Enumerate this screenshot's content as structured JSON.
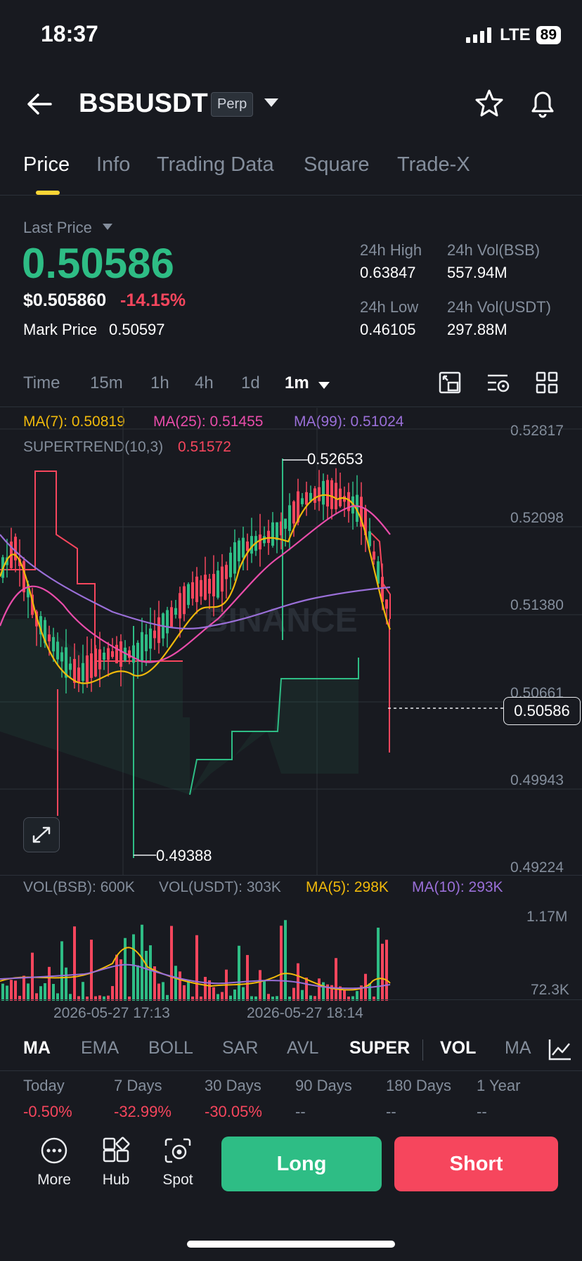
{
  "status_bar": {
    "time": "18:37",
    "network": "LTE",
    "battery": "89"
  },
  "header": {
    "symbol": "BSBUSDT",
    "contract_type": "Perp"
  },
  "tabs": [
    "Price",
    "Info",
    "Trading Data",
    "Square",
    "Trade-X"
  ],
  "price": {
    "last_price_label": "Last Price",
    "last_price": "0.50586",
    "usd_price": "$0.505860",
    "change": "-14.15%",
    "mark_price_label": "Mark Price",
    "mark_price": "0.50597",
    "stats": {
      "high_label": "24h High",
      "high": "0.63847",
      "vol_bsb_label": "24h Vol(BSB)",
      "vol_bsb": "557.94M",
      "low_label": "24h Low",
      "low": "0.46105",
      "vol_usdt_label": "24h Vol(USDT)",
      "vol_usdt": "297.88M"
    }
  },
  "interval_tabs": [
    "Time",
    "15m",
    "1h",
    "4h",
    "1d",
    "1m"
  ],
  "selected_interval": "1m",
  "ma_legend": {
    "ma7": "MA(7): 0.50819",
    "ma25": "MA(25): 0.51455",
    "ma99": "MA(99): 0.51024",
    "supertrend_label": "SUPERTREND(10,3)",
    "supertrend_value": "0.51572"
  },
  "watermark": "BINANCE",
  "vol_legend": {
    "vol_bsb": "VOL(BSB): 600K",
    "vol_usdt": "VOL(USDT): 303K",
    "ma5": "MA(5): 298K",
    "ma10": "MA(10): 293K"
  },
  "colors": {
    "up": "#2ebd85",
    "down": "#f6465d",
    "ma7": "#f0b90b",
    "ma25": "#e94caa",
    "ma99": "#9a6fd8",
    "accent": "#fcd535"
  },
  "chart_data": {
    "type": "candlestick",
    "price_axis_ticks": [
      "0.52817",
      "0.52098",
      "0.51380",
      "0.50661",
      "0.49943",
      "0.49224"
    ],
    "ylim": [
      0.49224,
      0.52817
    ],
    "high_label": "0.52653",
    "low_label": "0.49388",
    "last_price_tag": "0.50586",
    "volume_axis_ticks": [
      "1.17M",
      "72.3K"
    ],
    "x_tick_labels": [
      "2026-05-27 17:13",
      "2026-05-27 18:14"
    ]
  },
  "indicator_tabs": [
    "MA",
    "EMA",
    "BOLL",
    "SAR",
    "AVL",
    "SUPER",
    "VOL",
    "MA"
  ],
  "performance": [
    {
      "label": "Today",
      "value": "-0.50%"
    },
    {
      "label": "7 Days",
      "value": "-32.99%"
    },
    {
      "label": "30 Days",
      "value": "-30.05%"
    },
    {
      "label": "90 Days",
      "value": "--"
    },
    {
      "label": "180 Days",
      "value": "--"
    },
    {
      "label": "1 Year",
      "value": "--"
    }
  ],
  "bottom": {
    "more": "More",
    "hub": "Hub",
    "spot": "Spot",
    "long": "Long",
    "short": "Short"
  }
}
